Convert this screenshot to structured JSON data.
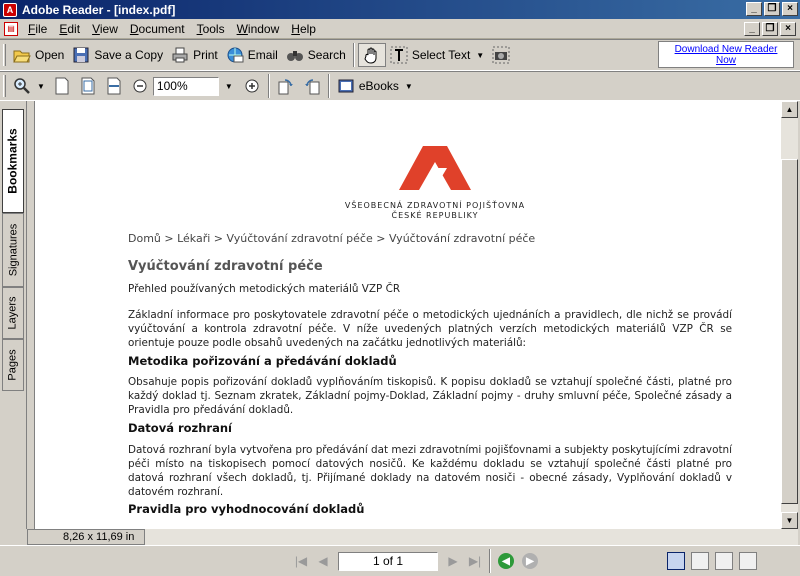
{
  "window": {
    "title": "Adobe Reader - [index.pdf]",
    "app_icon_letter": "A"
  },
  "menu": {
    "items": [
      "File",
      "Edit",
      "View",
      "Document",
      "Tools",
      "Window",
      "Help"
    ],
    "underline": [
      "F",
      "E",
      "V",
      "D",
      "T",
      "W",
      "H"
    ]
  },
  "toolbar1": {
    "open": "Open",
    "save_copy": "Save a Copy",
    "print": "Print",
    "email": "Email",
    "search": "Search",
    "select_text": "Select Text"
  },
  "toolbar2": {
    "zoom_value": "100%",
    "ebooks": "eBooks"
  },
  "ad": {
    "text": "Download New Reader Now"
  },
  "sidetabs": [
    "Bookmarks",
    "Signatures",
    "Layers",
    "Pages"
  ],
  "document": {
    "logo_line1": "VŠEOBECNÁ ZDRAVOTNÍ POJIŠŤOVNA",
    "logo_line2": "ČESKÉ REPUBLIKY",
    "breadcrumb": "Domů > Lékaři > Vyúčtování zdravotní péče > Vyúčtování zdravotní péče",
    "title": "Vyúčtování zdravotní péče",
    "subtitle": "Přehled používaných metodických materiálů VZP ČR",
    "intro": "Základní informace pro poskytovatele zdravotní péče o metodických ujednáních a pravidlech, dle nichž se provádí vyúčtování a kontrola zdravotní péče. V níže uvedených platných verzích metodických materiálů VZP ČR se orientuje pouze podle obsahů uvedených na začátku jednotlivých materiálů:",
    "sections": [
      {
        "heading": "Metodika pořizování a předávání dokladů",
        "text": "Obsahuje popis pořizování dokladů vyplňováním tiskopisů. K popisu dokladů se vztahují společné části, platné pro každý doklad tj. Seznam zkratek, Základní pojmy-Doklad, Základní pojmy - druhy smluvní péče, Společné zásady a Pravidla pro předávání dokladů."
      },
      {
        "heading": "Datová rozhraní",
        "text": "Datová rozhraní byla vytvořena pro předávání dat mezi zdravotními pojišťovnami a subjekty poskytujícími zdravotní péči místo na tiskopisech pomocí datových nosičů. Ke každému dokladu se vztahují společné části platné pro datová rozhraní všech dokladů, tj. Přijímané doklady na datovém nosiči - obecné zásady, Vyplňování dokladů v datovém rozhraní."
      },
      {
        "heading": "Pravidla pro vyhodnocování dokladů",
        "text": ""
      }
    ]
  },
  "status": {
    "page_size": "8,26 x 11,69 in",
    "page_indicator": "1 of 1"
  },
  "colors": {
    "title_bar_start": "#0a246a",
    "title_bar_end": "#3a6ea5",
    "logo_red": "#e0412a",
    "link_blue": "#0000ff"
  }
}
